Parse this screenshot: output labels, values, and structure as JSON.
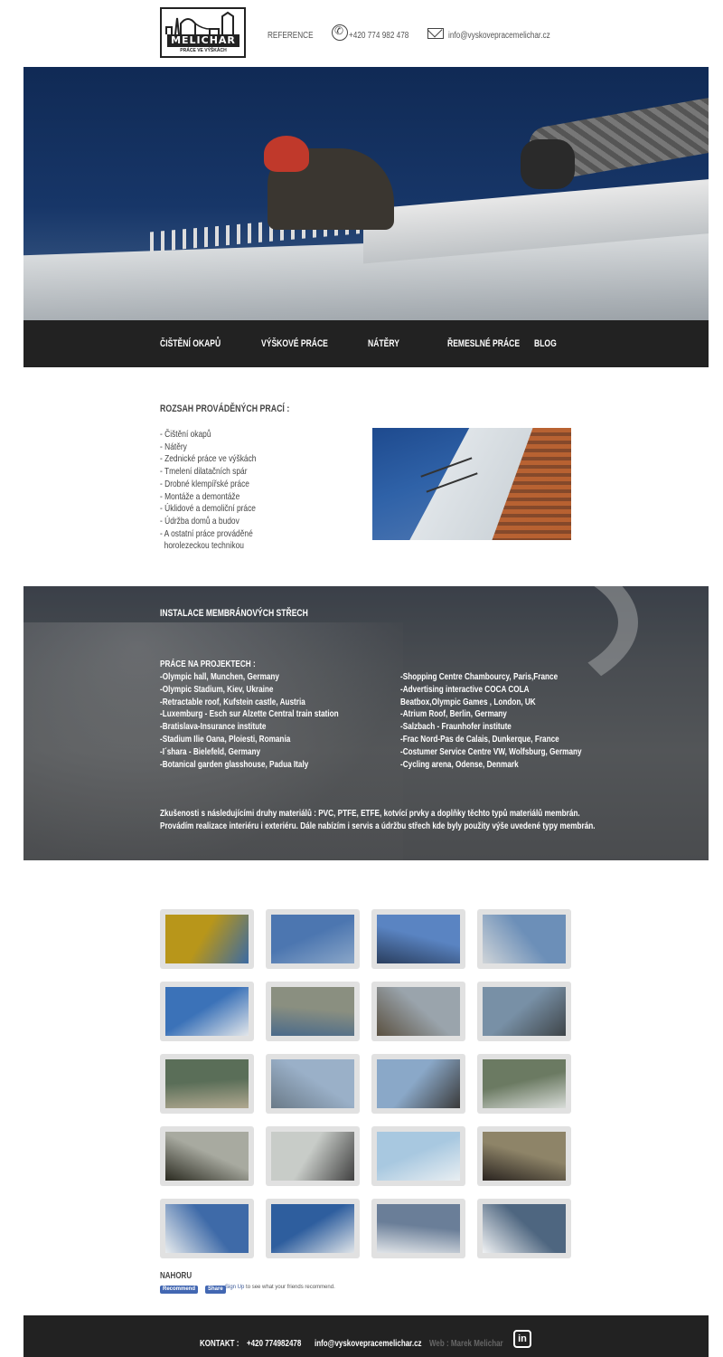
{
  "header": {
    "logo_text": "MELICHAR",
    "logo_sub": "PRÁCE VE VÝŠKÁCH",
    "reference": "REFERENCE",
    "phone": "+420 774 982 478",
    "email": "info@vyskovepracemelichar.cz",
    "phone_icon": "phone-icon",
    "mail_icon": "mail-icon"
  },
  "nav": {
    "items": [
      "ČIŠTĚNÍ OKAPŮ",
      "VÝŠKOVÉ PRÁCE",
      "NÁTĚRY",
      "ŘEMESLNÉ PRÁCE",
      "BLOG"
    ]
  },
  "scope": {
    "title": "ROZSAH PROVÁDĚNÝCH PRACÍ :",
    "items": [
      "- Čištění okapů",
      "- Nátěry",
      "- Zednické práce ve výškách",
      "- Tmelení dilatačních spár",
      "- Drobné klempířské práce",
      "- Montáže a demontáže",
      "- Úklidové a demoliční práce",
      "- Údržba domů a budov",
      "- A ostatní práce prováděné",
      "  horolezeckou technikou"
    ]
  },
  "membrane": {
    "title": "INSTALACE MEMBRÁNOVÝCH STŘECH",
    "projects_label": "PRÁCE NA PROJEKTECH :",
    "left": [
      "-Olympic hall, Munchen, Germany",
      "-Olympic Stadium, Kiev, Ukraine",
      "-Retractable roof, Kufstein castle, Austria",
      "-Luxemburg - Esch sur Alzette Central train station",
      "-Bratislava-Insurance institute",
      "-Stadium Ilie Oana, Ploiesti, Romania",
      "-I´shara - Bielefeld, Germany",
      "-Botanical garden glasshouse, Padua Italy"
    ],
    "right": [
      "-Shopping Centre Chambourcy, Paris,France",
      "-Advertising interactive COCA COLA",
      "Beatbox,Olympic Games , London, UK",
      "-Atrium Roof, Berlin, Germany",
      "-Salzbach - Fraunhofer institute",
      "-Frac Nord-Pas de Calais, Dunkerque, France",
      "-Costumer Service Centre VW, Wolfsburg, Germany",
      "-Cycling arena, Odense, Denmark"
    ],
    "note_line1": "Zkušenosti s následujícími druhy materiálů : PVC, PTFE, ETFE, kotvící prvky a doplňky těchto typů materiálů membrán.",
    "note_line2": "Provádím realizace interiéru i exteriéru. Dále nabízím i servis a údržbu střech kde byly použity výše uvedené typy membrán."
  },
  "gallery": {
    "colors": [
      [
        "#b8961a",
        "#3b6aa3"
      ],
      [
        "#4c76b0",
        "#8aa6c8"
      ],
      [
        "#5a84c2",
        "#2a3e5e"
      ],
      [
        "#6c8fb8",
        "#cfd4d8"
      ],
      [
        "#3b72b8",
        "#e2e6ea"
      ],
      [
        "#8a8f80",
        "#4a6a8a"
      ],
      [
        "#9aa4ac",
        "#5a5040"
      ],
      [
        "#7890a6",
        "#3e4448"
      ],
      [
        "#5a6e58",
        "#b0a890"
      ],
      [
        "#9ab0c8",
        "#6a7a88"
      ],
      [
        "#8aa8c8",
        "#3a3a3a"
      ],
      [
        "#6b7a62",
        "#d8dcd8"
      ],
      [
        "#a8aaa0",
        "#2a2a20"
      ],
      [
        "#c8ccc8",
        "#404040"
      ],
      [
        "#a8c8e0",
        "#e8eef2"
      ],
      [
        "#8e8468",
        "#2a2420"
      ],
      [
        "#3e6aa8",
        "#e8ecee"
      ],
      [
        "#2e5e9e",
        "#dfe4e8"
      ],
      [
        "#6a7e98",
        "#e0e4e8"
      ],
      [
        "#4e6680",
        "#f0f2f4"
      ]
    ]
  },
  "bottom": {
    "nahoru": "NAHORU",
    "fb_recommend": "Recommend",
    "fb_share": "Share",
    "fb_signup": "Sign Up",
    "fb_text": " to see what your friends recommend."
  },
  "footer": {
    "kontakt": "KONTAKT :",
    "phone": "+420 774982478",
    "email": "info@vyskovepracemelichar.cz",
    "web": "Web : Marek Melichar",
    "linkedin": "in"
  }
}
